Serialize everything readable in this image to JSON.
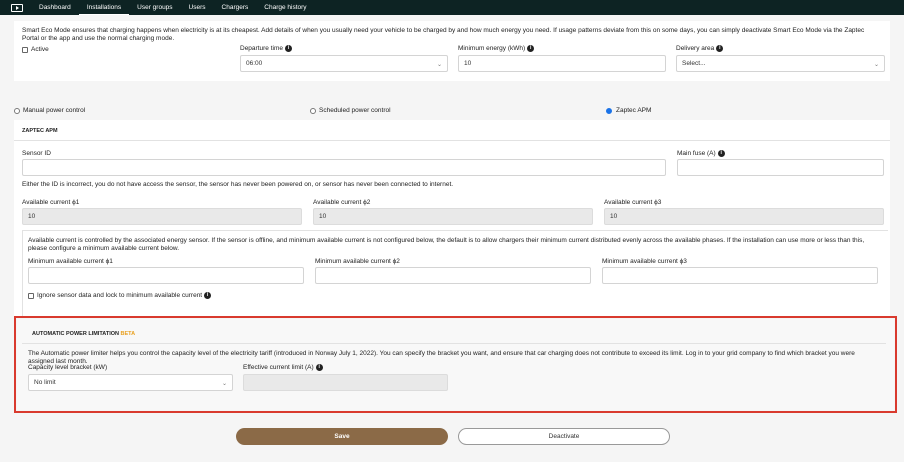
{
  "nav": {
    "logo_icon": "play-screen-icon",
    "items": [
      "Dashboard",
      "Installations",
      "User groups",
      "Users",
      "Chargers",
      "Charge history"
    ]
  },
  "eco": {
    "description": "Smart Eco Mode ensures that charging happens when electricity is at its cheapest. Add details of when you usually need your vehicle to be charged by and how much energy you need. If usage patterns deviate from this on some days, you can simply deactivate Smart Eco Mode via the Zaptec Portal or the app and use the normal charging mode.",
    "active_label": "Active",
    "departure_label": "Departure time",
    "departure_value": "06:00",
    "min_energy_label": "Minimum energy (kWh)",
    "min_energy_value": "10",
    "delivery_label": "Delivery area",
    "delivery_value": "Select..."
  },
  "power": {
    "manual_label": "Manual power control",
    "scheduled_label": "Scheduled power control",
    "apm_label": "Zaptec APM"
  },
  "apm": {
    "heading": "ZAPTEC APM",
    "sensor_label": "Sensor ID",
    "sensor_value": "",
    "main_fuse_label": "Main fuse (A)",
    "main_fuse_value": "",
    "error_text": "Either the ID is incorrect, you do not have access the sensor, the sensor has never been powered on, or sensor has never been connected to internet.",
    "phase1_label": "Available current ϕ1",
    "phase1_value": "10",
    "phase2_label": "Available current ϕ2",
    "phase2_value": "10",
    "phase3_label": "Available current ϕ3",
    "phase3_value": "10",
    "info_text": "Available current is controlled by the associated energy sensor. If the sensor is offline, and minimum available current is not configured below, the default is to allow chargers their minimum current distributed evenly across the available phases. If the installation can use more or less than this, please configure a minimum available current below.",
    "min1_label": "Minimum available current ϕ1",
    "min2_label": "Minimum available current ϕ2",
    "min3_label": "Minimum available current ϕ3",
    "ignore_label": "Ignore sensor data and lock to minimum available current"
  },
  "limitation": {
    "heading": "AUTOMATIC POWER LIMITATION",
    "beta": "BETA",
    "description": "The Automatic power limiter helps you control the capacity level of the electricity tariff (introduced in Norway July 1, 2022). You can specify the bracket you want, and ensure that car charging does not contribute to exceed its limit. Log in to your grid company to find which bracket you were assigned last month.",
    "capacity_label": "Capacity level bracket (kW)",
    "capacity_value": "No limit",
    "effective_label": "Effective current limit (A)",
    "effective_value": ""
  },
  "actions": {
    "save": "Save",
    "deactivate": "Deactivate"
  },
  "colors": {
    "nav_bg": "#0d2323",
    "save_bg": "#8b6a47",
    "highlight": "#d93a2e",
    "beta": "#e8a020",
    "radio_on": "#1a73e8"
  }
}
